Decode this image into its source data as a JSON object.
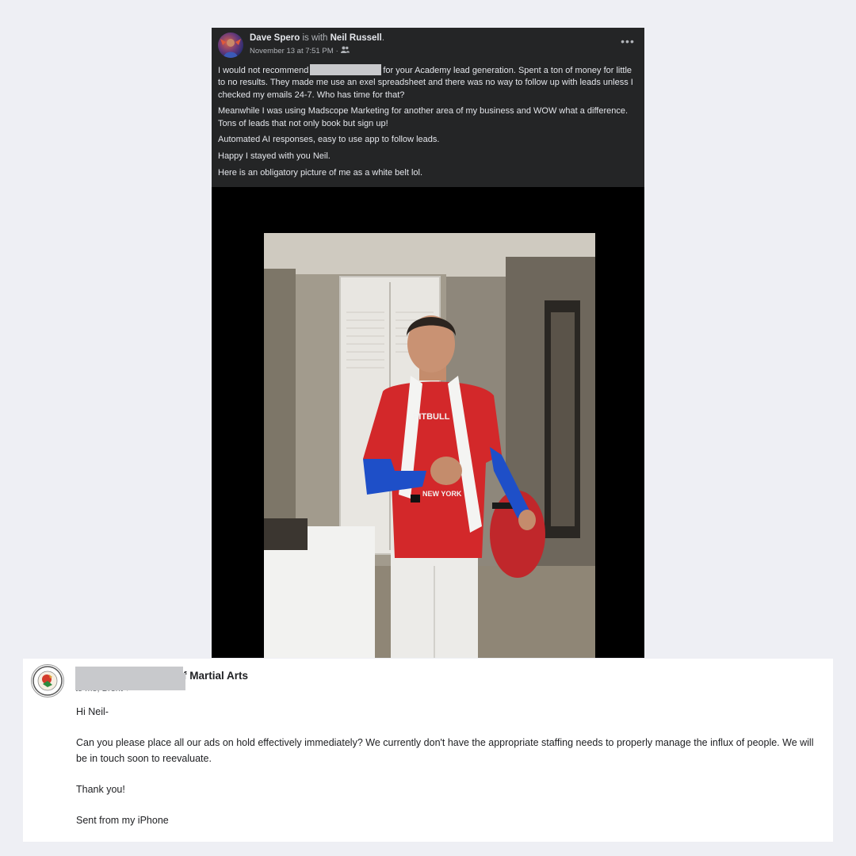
{
  "post": {
    "author": "Dave Spero",
    "with_text": " is with ",
    "tagged": "Neil Russell",
    "period": ".",
    "timestamp": "November 13 at 7:51 PM",
    "separator": " · ",
    "audience_icon": "friends-icon",
    "more_icon": "more-options-icon",
    "more_label": "•••",
    "paragraphs": {
      "p1_before": "I would not recommend",
      "p1_after": "for your Academy lead generation. Spent a ton of money for little to no results. They made me use an exel spreadsheet and there was no way to follow up with leads unless I checked my emails 24-7. Who has time for that?",
      "p2": "Meanwhile I was using Madscope Marketing for another area of my business and WOW what a difference. Tons of leads that not only book but sign up!",
      "p3": "Automated AI responses, easy to use app to follow leads.",
      "p4": "Happy I stayed with you Neil.",
      "p5": "Here is an obligatory picture of me as a white belt lol."
    },
    "photo_shirt_text_1": "PITBULL",
    "photo_shirt_text_2": "NEW YORK"
  },
  "email": {
    "sender_suffix": "f Martial Arts",
    "to_line": "to me, Brent",
    "chevron_icon": "chevron-down-icon",
    "chevron_glyph": "▾",
    "greeting": "Hi Neil-",
    "body": "Can you please place all our ads on hold effectively immediately? We currently don't have the appropriate staffing needs to properly manage the influx of people. We will be in touch soon to reevaluate.",
    "thanks": "Thank you!",
    "signature": "Sent from my iPhone"
  },
  "colors": {
    "page_bg": "#eeeff4",
    "fb_card_bg": "#242526",
    "fb_text": "#e4e6eb",
    "fb_secondary": "#b0b3b8",
    "redaction": "#c8c9cc",
    "email_bg": "#ffffff"
  }
}
